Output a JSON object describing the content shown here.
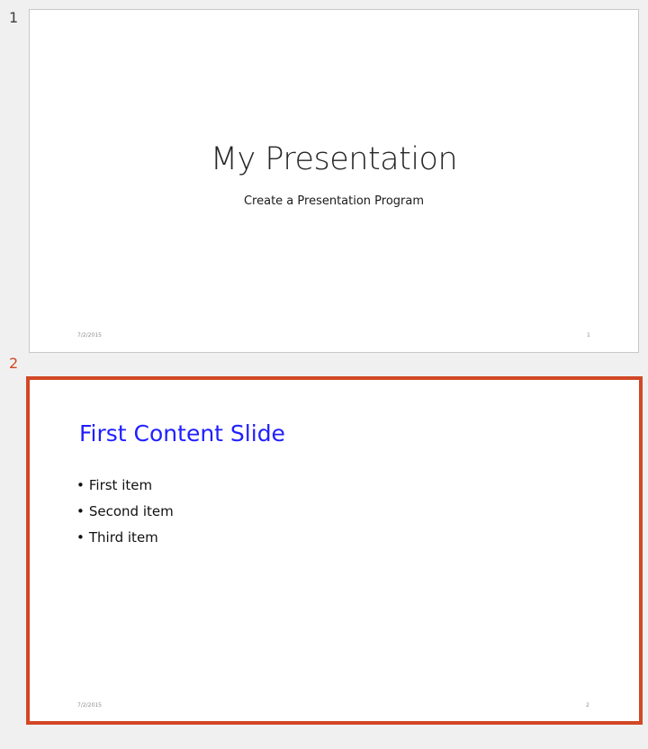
{
  "slides": [
    {
      "number": "1",
      "title": "My Presentation",
      "subtitle": "Create a Presentation Program",
      "footer_date": "7/2/2015",
      "footer_number": "1"
    },
    {
      "number": "2",
      "title": "First Content Slide",
      "items": [
        "First item",
        "Second item",
        "Third item"
      ],
      "footer_date": "7/2/2015",
      "footer_number": "2"
    }
  ],
  "colors": {
    "selection_border": "#d24726",
    "content_title": "#1f1fff",
    "background": "#f0f0f0"
  }
}
